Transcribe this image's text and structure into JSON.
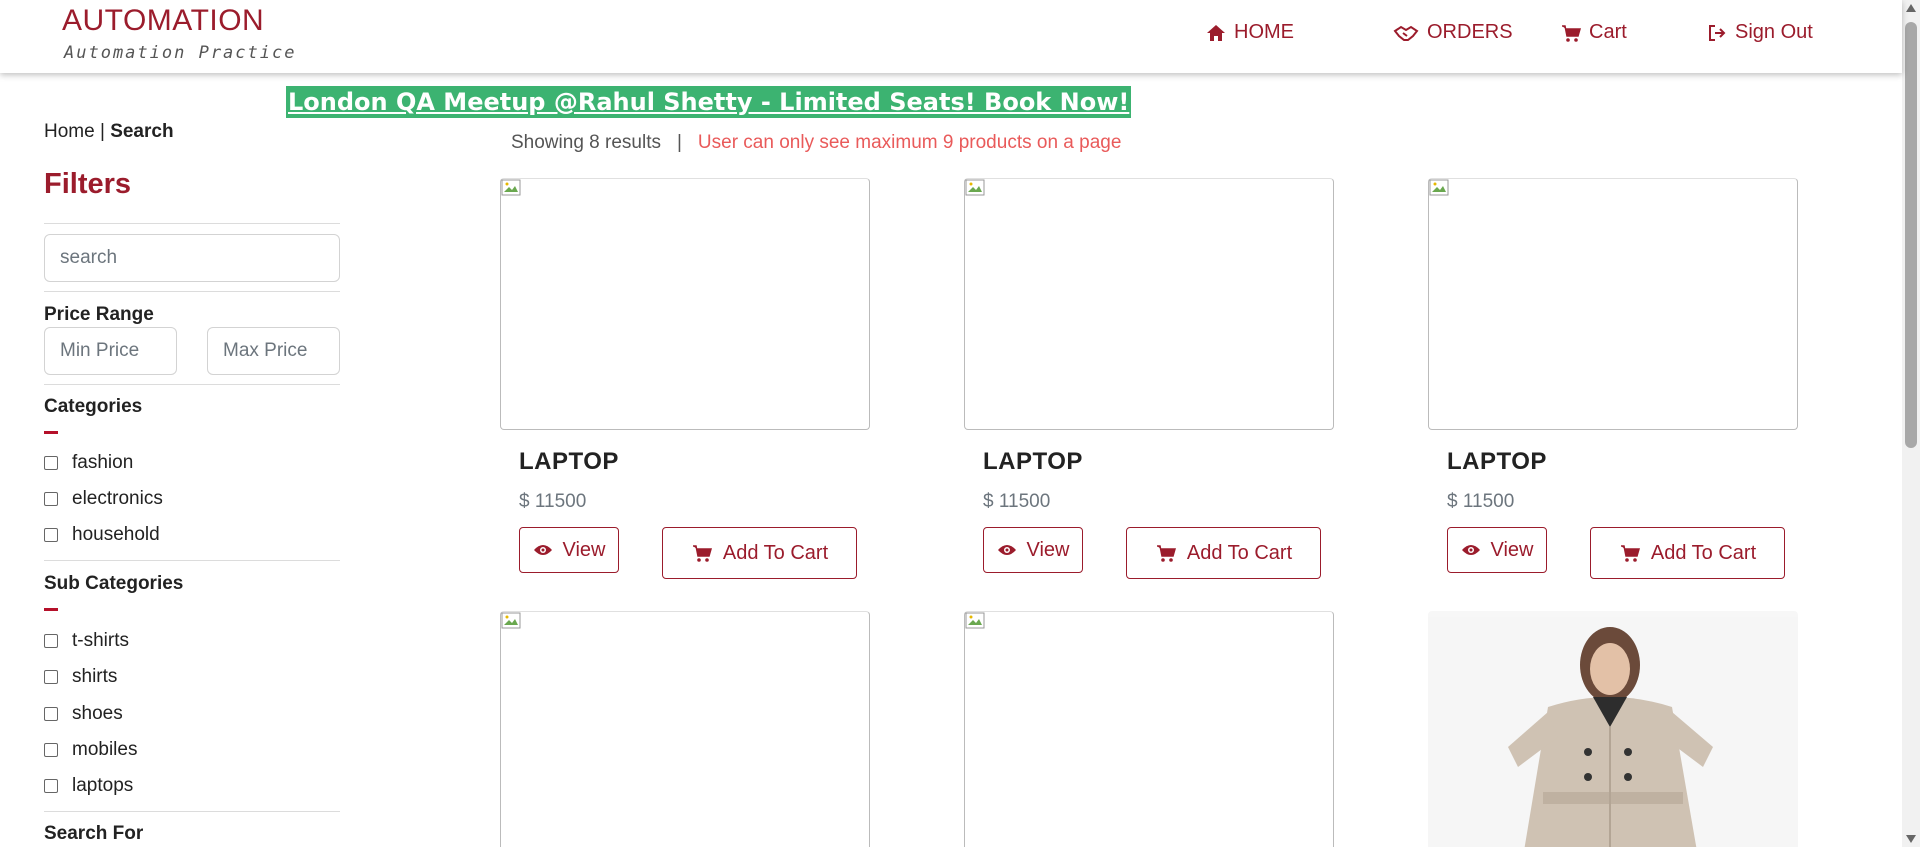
{
  "brand": {
    "title": "AUTOMATION",
    "subtitle": "Automation Practice"
  },
  "nav": {
    "home": "HOME",
    "orders": "ORDERS",
    "cart": "Cart",
    "signout": "Sign Out"
  },
  "promo": {
    "text": "London QA Meetup @Rahul Shetty - Limited Seats! Book Now!"
  },
  "breadcrumb": {
    "home": "Home",
    "sep": " | ",
    "current": "Search"
  },
  "sidebar": {
    "filters_title": "Filters",
    "search_placeholder": "search",
    "price_range_label": "Price Range",
    "min_price_placeholder": "Min Price",
    "max_price_placeholder": "Max Price",
    "categories_label": "Categories",
    "categories": [
      "fashion",
      "electronics",
      "household"
    ],
    "subcategories_label": "Sub Categories",
    "subcategories": [
      "t-shirts",
      "shirts",
      "shoes",
      "mobiles",
      "laptops"
    ],
    "search_for_label": "Search For"
  },
  "results": {
    "showing": "Showing 8 results",
    "sep": "|",
    "warning": "User can only see maximum 9 products on a page"
  },
  "products": [
    {
      "name": "LAPTOP",
      "price": "$ 11500",
      "view_label": "View",
      "cart_label": "Add To Cart"
    },
    {
      "name": "LAPTOP",
      "price": "$ 11500",
      "view_label": "View",
      "cart_label": "Add To Cart"
    },
    {
      "name": "LAPTOP",
      "price": "$ 11500",
      "view_label": "View",
      "cart_label": "Add To Cart"
    }
  ],
  "colors": {
    "brand": "#9b1c2c",
    "promo_bg": "#3cb371",
    "warning": "#e95a5a"
  }
}
